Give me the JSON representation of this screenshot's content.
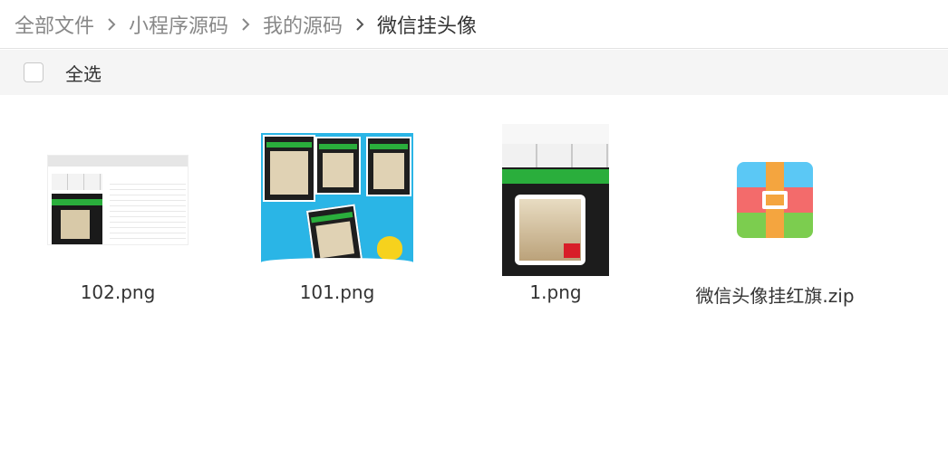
{
  "breadcrumb": {
    "items": [
      "全部文件",
      "小程序源码",
      "我的源码"
    ],
    "current": "微信挂头像"
  },
  "toolbar": {
    "select_all_label": "全选",
    "select_all_checked": false
  },
  "files": [
    {
      "name": "102.png",
      "type": "image"
    },
    {
      "name": "101.png",
      "type": "image"
    },
    {
      "name": "1.png",
      "type": "image"
    },
    {
      "name": "微信头像挂红旗.zip",
      "type": "zip"
    }
  ],
  "colors": {
    "accent_green": "#2aae3c",
    "sky_blue": "#2ab5e6",
    "zip_blue": "#5bc8f5",
    "zip_red": "#f36b6b",
    "zip_green": "#7ccd4f",
    "zip_strap": "#f4a53f"
  },
  "icons": {
    "separator": "chevron-right-icon",
    "zip": "zip-archive-icon"
  }
}
